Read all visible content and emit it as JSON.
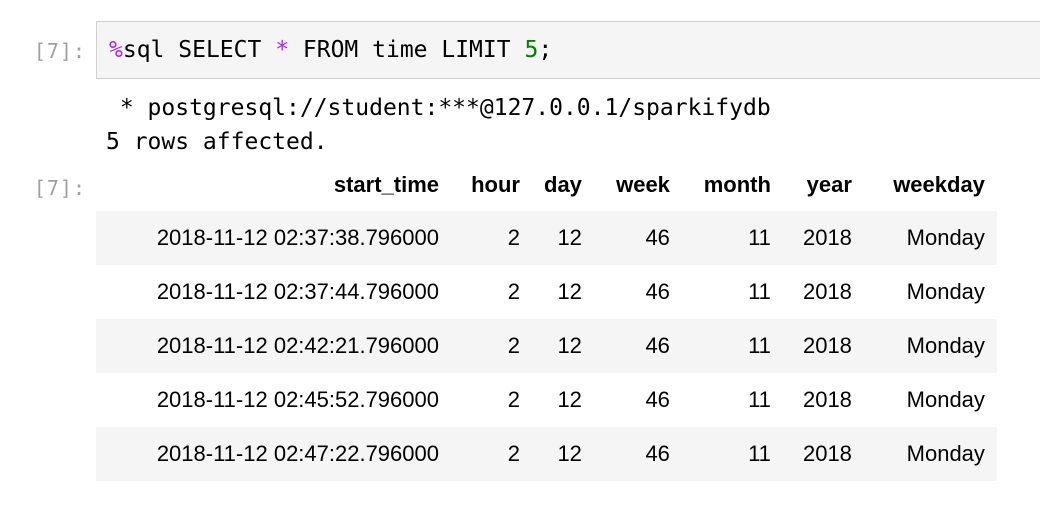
{
  "input_cell": {
    "prompt": "[7]:",
    "code_tokens": {
      "magic": "%",
      "keyword_sql": "sql SELECT ",
      "star": "*",
      "from_clause": " FROM time LIMIT ",
      "limit_value": "5",
      "terminator": ";"
    }
  },
  "stdout": {
    "connection_line": " * postgresql://student:***@127.0.0.1/sparkifydb",
    "rows_line": "5 rows affected."
  },
  "output_cell": {
    "prompt": "[7]:",
    "columns": [
      "start_time",
      "hour",
      "day",
      "week",
      "month",
      "year",
      "weekday"
    ],
    "rows": [
      [
        "2018-11-12 02:37:38.796000",
        "2",
        "12",
        "46",
        "11",
        "2018",
        "Monday"
      ],
      [
        "2018-11-12 02:37:44.796000",
        "2",
        "12",
        "46",
        "11",
        "2018",
        "Monday"
      ],
      [
        "2018-11-12 02:42:21.796000",
        "2",
        "12",
        "46",
        "11",
        "2018",
        "Monday"
      ],
      [
        "2018-11-12 02:45:52.796000",
        "2",
        "12",
        "46",
        "11",
        "2018",
        "Monday"
      ],
      [
        "2018-11-12 02:47:22.796000",
        "2",
        "12",
        "46",
        "11",
        "2018",
        "Monday"
      ]
    ]
  },
  "colors": {
    "magic": "#aa22ff",
    "number": "#008000",
    "prompt": "#a0a0a0",
    "cell_background": "#f5f5f5",
    "cell_border": "#cfcfcf"
  }
}
